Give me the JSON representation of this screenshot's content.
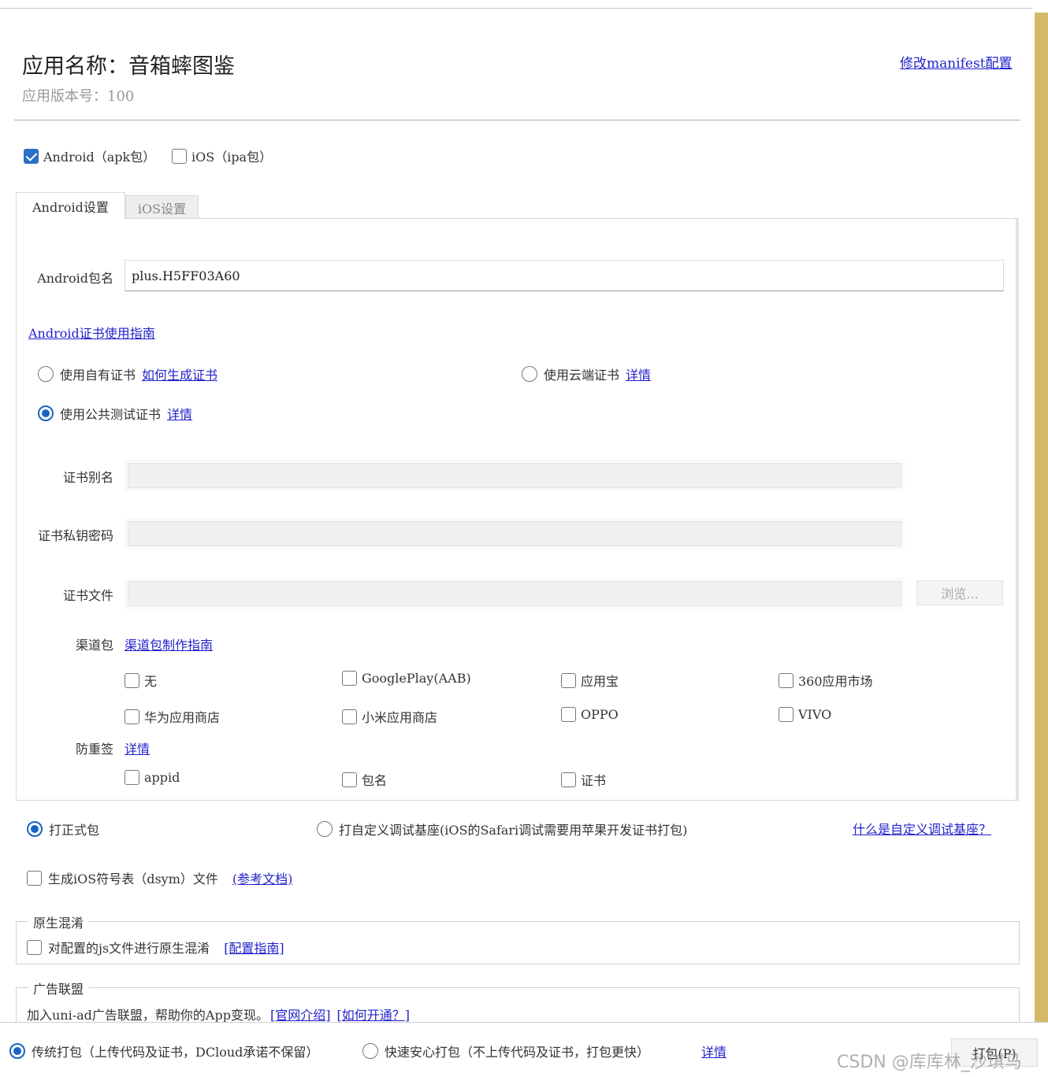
{
  "header": {
    "app_name_label": "应用名称：",
    "app_name": "音箱蟀图鉴",
    "version_label": "应用版本号：",
    "version": "100",
    "manifest_link": "修改manifest配置"
  },
  "platforms": {
    "android": {
      "label": "Android（apk包）",
      "checked": true
    },
    "ios": {
      "label": "iOS（ipa包）",
      "checked": false
    }
  },
  "tabs": {
    "android": "Android设置",
    "ios": "iOS设置"
  },
  "android": {
    "package_label": "Android包名",
    "package_value": "plus.H5FF03A60",
    "cert_guide_link": "Android证书使用指南",
    "own_cert": {
      "label": "使用自有证书",
      "link": "如何生成证书",
      "checked": false
    },
    "cloud_cert": {
      "label": "使用云端证书",
      "link": "详情",
      "checked": false
    },
    "public_cert": {
      "label": "使用公共测试证书",
      "link": "详情",
      "checked": true
    },
    "alias_label": "证书别名",
    "key_password_label": "证书私钥密码",
    "cert_file_label": "证书文件",
    "browse_button": "浏览...",
    "channel_label": "渠道包",
    "channel_guide_link": "渠道包制作指南",
    "channels": [
      "无",
      "GooglePlay(AAB)",
      "应用宝",
      "360应用市场",
      "华为应用商店",
      "小米应用商店",
      "OPPO",
      "VIVO"
    ],
    "anti_resign_label": "防重签",
    "anti_resign_link": "详情",
    "anti_resign_options": [
      "appid",
      "包名",
      "证书"
    ]
  },
  "build_type": {
    "formal": {
      "label": "打正式包",
      "checked": true
    },
    "custom_base": {
      "label": "打自定义调试基座(iOS的Safari调试需要用苹果开发证书打包)",
      "checked": false
    },
    "what_is_link": "什么是自定义调试基座？"
  },
  "dsym": {
    "label": "生成iOS符号表（dsym）文件",
    "link": "(参考文档)"
  },
  "native_obfuscation": {
    "legend": "原生混淆",
    "label": "对配置的js文件进行原生混淆",
    "link": "[配置指南]"
  },
  "ad_union": {
    "legend": "广告联盟",
    "text": "加入uni-ad广告联盟，帮助你的App变现。",
    "link1": "[官网介绍]",
    "link2": "[如何开通？]"
  },
  "bottom": {
    "traditional": {
      "label": "传统打包（上传代码及证书，DCloud承诺不保留）",
      "checked": true
    },
    "fast": {
      "label": "快速安心打包（不上传代码及证书，打包更快）",
      "checked": false
    },
    "details_link": "详情",
    "pack_button": "打包(P)"
  },
  "watermark": "CSDN @库库林_沙琪马",
  "colors": {
    "accent": "#1a63c2",
    "link": "#2222cc",
    "scrollbar": "#d4b96a"
  }
}
